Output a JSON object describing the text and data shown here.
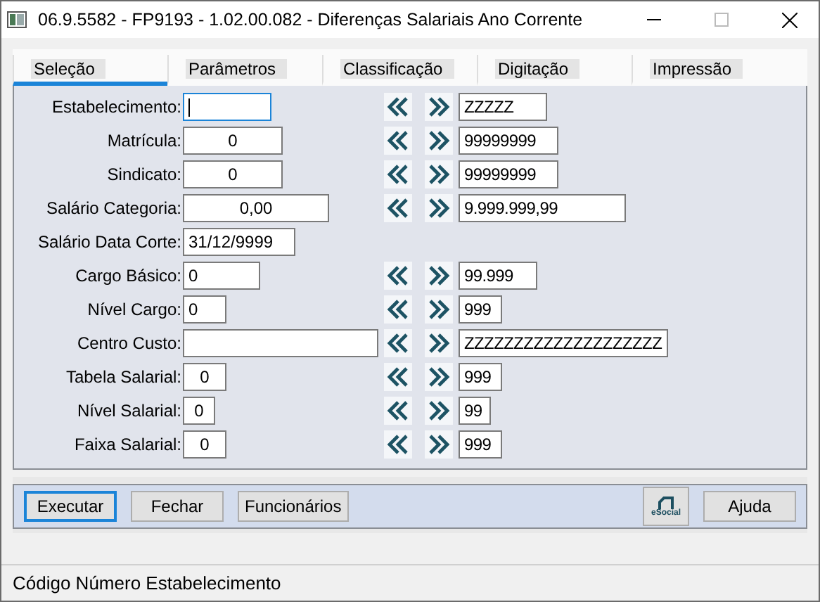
{
  "window": {
    "title": "06.9.5582 - FP9193 - 1.02.00.082 - Diferenças Salariais Ano Corrente"
  },
  "tabs": [
    {
      "label": "Seleção",
      "selected": true
    },
    {
      "label": "Parâmetros",
      "selected": false
    },
    {
      "label": "Classificação",
      "selected": false
    },
    {
      "label": "Digitação",
      "selected": false
    },
    {
      "label": "Impressão",
      "selected": false
    }
  ],
  "fields": [
    {
      "kind": "range",
      "label": "Estabelecimento:",
      "focused": true,
      "to": "ZZZZZ"
    },
    {
      "kind": "range",
      "label": "Matrícula:",
      "value": "0",
      "focused": false,
      "to": "99999999"
    },
    {
      "kind": "range",
      "label": "Sindicato:",
      "value": "0",
      "focused": false,
      "to": "99999999"
    },
    {
      "kind": "range",
      "label": "Salário Categoria:",
      "value": "0,00",
      "focused": false,
      "to": "9.999.999,99"
    },
    {
      "kind": "single",
      "label": "Salário Data Corte:",
      "value": "31/12/9999",
      "focused": false
    },
    {
      "kind": "range",
      "label": "Cargo Básico:",
      "value": "0",
      "focused": false,
      "to": "99.999"
    },
    {
      "kind": "range",
      "label": "Nível Cargo:",
      "value": "0",
      "focused": false,
      "to": "999"
    },
    {
      "kind": "range",
      "label": "Centro Custo:",
      "focused": false,
      "to": "ZZZZZZZZZZZZZZZZZZZZ"
    },
    {
      "kind": "range",
      "label": "Tabela Salarial:",
      "value": "0",
      "focused": false,
      "to": "999"
    },
    {
      "kind": "range",
      "label": "Nível Salarial:",
      "value": "0",
      "focused": false,
      "to": "99"
    },
    {
      "kind": "range",
      "label": "Faixa Salarial:",
      "value": "0",
      "focused": false,
      "to": "999"
    }
  ],
  "buttons": [
    {
      "label": "Executar",
      "kind": "text",
      "default": true
    },
    {
      "label": "Fechar",
      "kind": "text",
      "default": false
    },
    {
      "label": "Funcionários",
      "kind": "text",
      "default": false
    },
    {
      "label": "eSocial",
      "kind": "logo",
      "default": false
    },
    {
      "label": "Ajuda",
      "kind": "text",
      "default": false
    }
  ],
  "status_bar": {
    "text": "Código Número Estabelecimento"
  }
}
